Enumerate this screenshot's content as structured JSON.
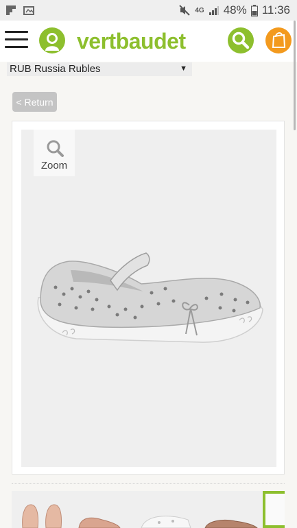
{
  "status_bar": {
    "network": "4G",
    "battery": "48%",
    "time": "11:36"
  },
  "header": {
    "brand": "vertbaudet",
    "menu_icon": "hamburger-menu-icon",
    "avatar_icon": "child-avatar-icon",
    "search_icon": "search-icon",
    "bag_icon": "shopping-bag-icon"
  },
  "currency": {
    "selected": "RUB Russia Rubles"
  },
  "nav": {
    "return_label": "< Return"
  },
  "product": {
    "zoom_label": "Zoom"
  },
  "colors": {
    "brand_green": "#8dbf2e",
    "bag_orange": "#f39a1e",
    "thumb_selected": "#8dbf2e"
  }
}
